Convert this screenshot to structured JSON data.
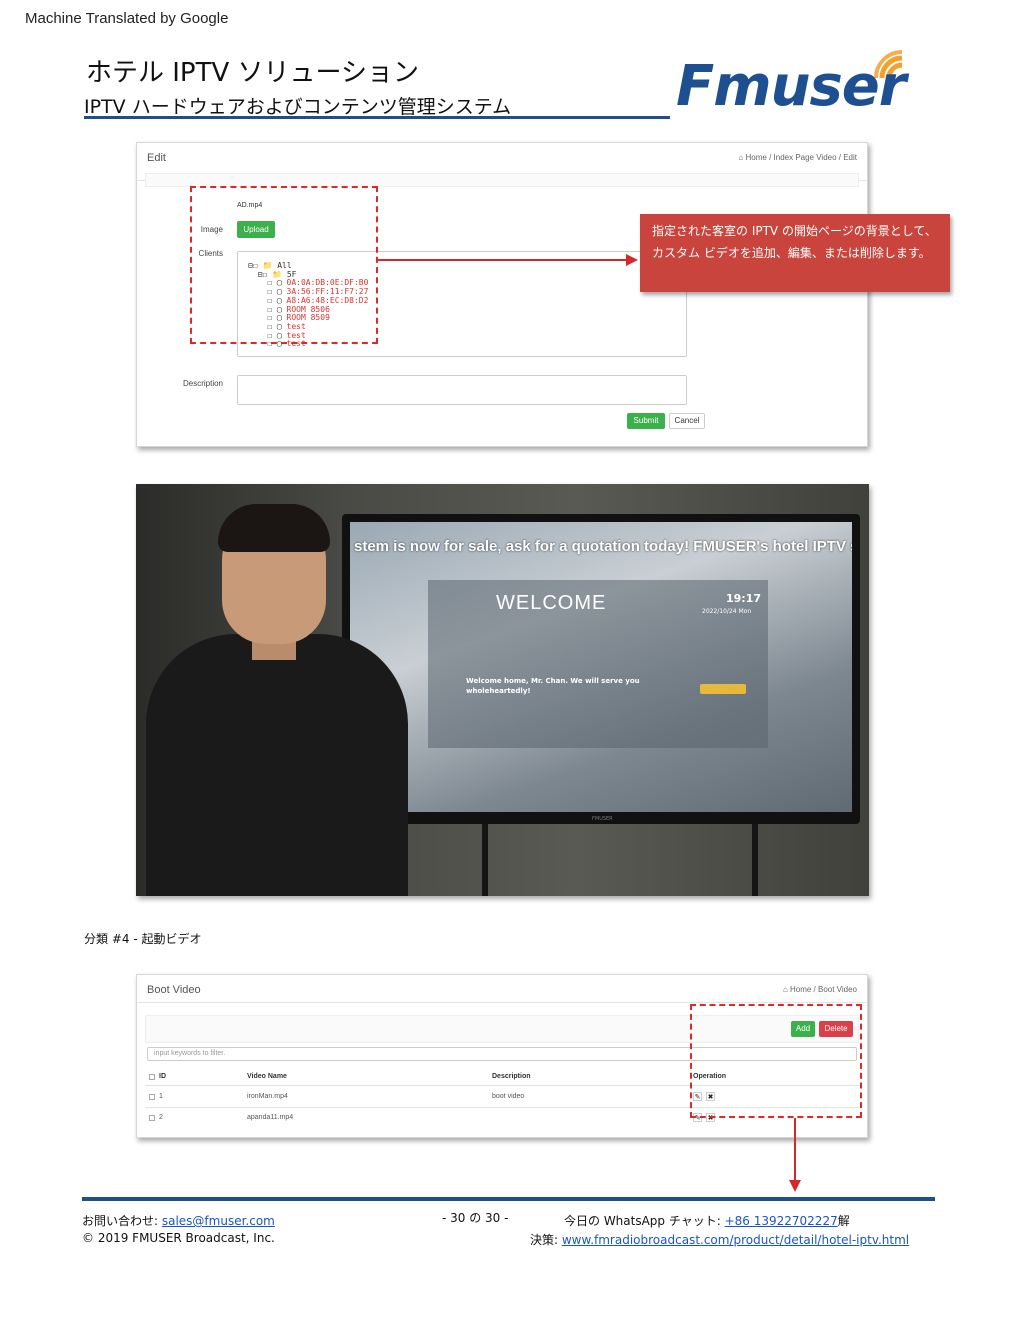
{
  "banner": "Machine Translated by Google",
  "header": {
    "title": "ホテル IPTV ソリューション",
    "subtitle": "IPTV ハードウェアおよびコンテンツ管理システム",
    "logo_text": "Fmuser",
    "brand_color": "#1d4f91"
  },
  "edit_screen": {
    "panel_title": "Edit",
    "breadcrumb": "⌂ Home / Index Page Video / Edit",
    "file_name": "AD.mp4",
    "image_label": "Image",
    "upload_label": "Upload",
    "clients_label": "Clients",
    "tree": [
      {
        "prefix": "⊟☐ 📁",
        "text": "All",
        "highlight": false
      },
      {
        "prefix": "  ⊟☐ 📁",
        "text": "5F",
        "highlight": false
      },
      {
        "prefix": "    ☐ ▢",
        "text": "0A:0A:DB:0E:DF:B0",
        "highlight": true
      },
      {
        "prefix": "    ☐ ▢",
        "text": "3A:56:FF:11:F7:27",
        "highlight": true
      },
      {
        "prefix": "    ☐ ▢",
        "text": "A8:A6:48:EC:D8:D2",
        "highlight": true
      },
      {
        "prefix": "    ☐ ▢",
        "text": "ROOM 8506",
        "highlight": true
      },
      {
        "prefix": "    ☐ ▢",
        "text": "ROOM 8509",
        "highlight": true
      },
      {
        "prefix": "    ☐ ▢",
        "text": "test",
        "highlight": true
      },
      {
        "prefix": "    ☐ ▢",
        "text": "test",
        "highlight": true
      },
      {
        "prefix": "    ☐ ▢",
        "text": "test",
        "highlight": true
      }
    ],
    "description_label": "Description",
    "submit_label": "Submit",
    "cancel_label": "Cancel"
  },
  "callout": {
    "text": "指定された客室の IPTV の開始ページの背景として、カスタム ビデオを追加、編集、または削除します。",
    "color": "#c8443c"
  },
  "tv_photo": {
    "ticker": "stem is now for sale, ask for a quotation today! FMUSER's hotel IPTV sy",
    "welcome": "WELCOME",
    "time": "19:17",
    "date": "2022/10/24 Mon",
    "greeting": "Welcome home, Mr. Chan. We will serve you wholeheartedly!",
    "brand": "FMUSER"
  },
  "caption": "分類 #4 - 起動ビデオ",
  "boot_screen": {
    "panel_title": "Boot Video",
    "breadcrumb": "⌂ Home / Boot Video",
    "add_label": "Add",
    "delete_label": "Delete",
    "search_placeholder": "input keywords to filter.",
    "columns": [
      "ID",
      "Video Name",
      "Description",
      "Operation"
    ],
    "rows": [
      {
        "id": "1",
        "name": "ironMan.mp4",
        "description": "boot video"
      },
      {
        "id": "2",
        "name": "apanda11.mp4",
        "description": ""
      }
    ],
    "edit_icon": "✎",
    "delete_icon": "✖"
  },
  "footer": {
    "contact_label": "お問い合わせ: ",
    "email": "sales@fmuser.com",
    "copyright": "© 2019 FMUSER Broadcast, Inc.",
    "page": "- 30 の 30 -",
    "whatsapp_label": "今日の WhatsApp チャット: ",
    "phone": "+86 13922702227",
    "phone_suffix": "解",
    "solution_label": "決策: ",
    "url": "www.fmradiobroadcast.com/product/detail/hotel-iptv.html",
    "rule_color": "#1f4e8c"
  }
}
